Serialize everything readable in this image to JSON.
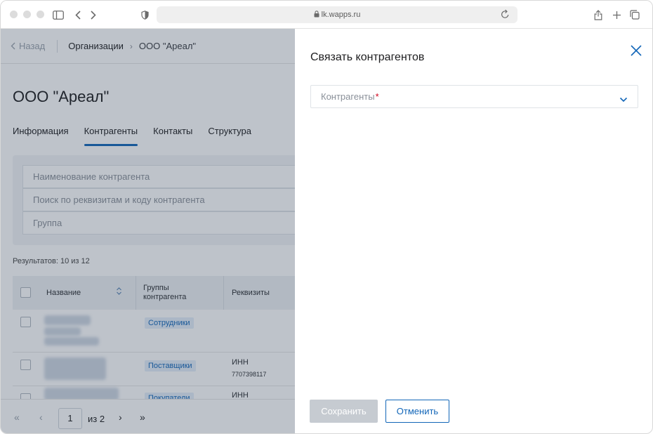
{
  "browser": {
    "url": "lk.wapps.ru"
  },
  "breadcrumb": {
    "back": "Назад",
    "items": [
      "Организации",
      "ООО \"Ареал\""
    ]
  },
  "page": {
    "title": "ООО \"Ареал\"",
    "tabs": [
      {
        "label": "Информация",
        "active": false
      },
      {
        "label": "Контрагенты",
        "active": true
      },
      {
        "label": "Контакты",
        "active": false
      },
      {
        "label": "Структура",
        "active": false
      }
    ],
    "filters": {
      "name_placeholder": "Наименование контрагента",
      "search_placeholder": "Поиск по реквизитам и коду контрагента",
      "group_placeholder": "Группа"
    },
    "results": "Результатов: 10 из 12",
    "table": {
      "headers": {
        "name": "Название",
        "groups": "Группы контрагента",
        "requisites": "Реквизиты"
      },
      "rows": [
        {
          "group": "Сотрудники",
          "req_label": "",
          "req_value": ""
        },
        {
          "group": "Поставщики",
          "req_label": "ИНН",
          "req_value": "7707398117"
        },
        {
          "group": "Покупатели",
          "req_label": "ИНН",
          "req_value": ""
        }
      ]
    },
    "pagination": {
      "current": "1",
      "of": "из 2"
    }
  },
  "panel": {
    "title": "Связать контрагентов",
    "select_placeholder": "Контрагенты",
    "required_mark": "*",
    "save_label": "Сохранить",
    "cancel_label": "Отменить"
  },
  "colors": {
    "accent": "#1266b8",
    "disabled_button": "#c6cbd1",
    "required": "#d0021b"
  }
}
